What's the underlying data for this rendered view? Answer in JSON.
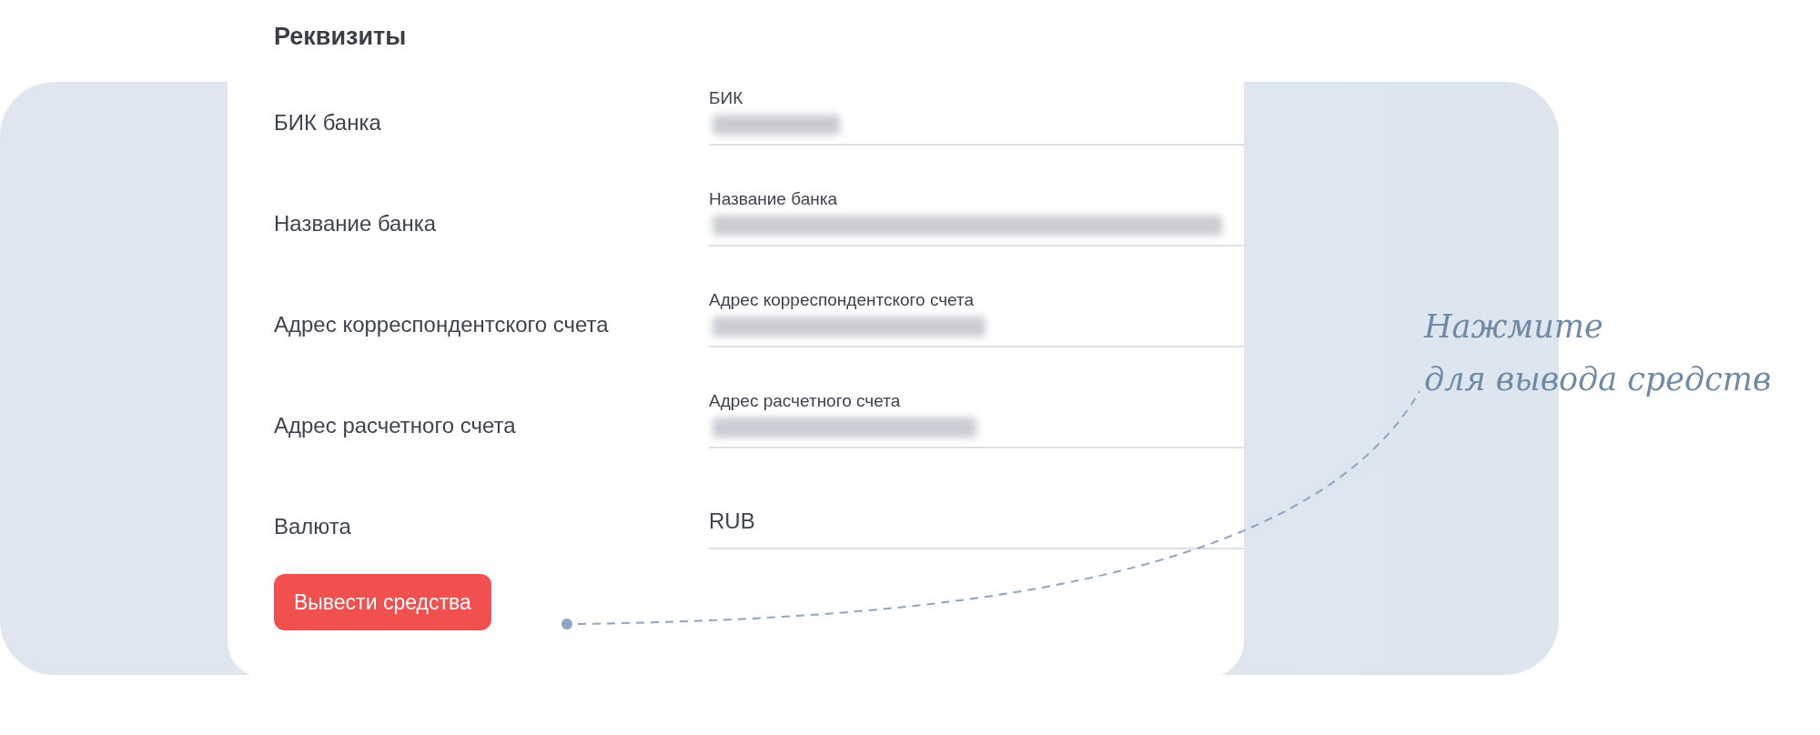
{
  "card": {
    "title": "Реквизиты",
    "rows": [
      {
        "label": "БИК банка",
        "field_label": "БИК",
        "kind": "masked"
      },
      {
        "label": "Название банка",
        "field_label": "Название банка",
        "kind": "masked"
      },
      {
        "label": "Адрес корреспондентского счета",
        "field_label": "Адрес корреспондентского счета",
        "kind": "masked"
      },
      {
        "label": "Адрес расчетного счета",
        "field_label": "Адрес расчетного счета",
        "kind": "masked"
      },
      {
        "label": "Валюта",
        "value": "RUB",
        "kind": "plain"
      }
    ],
    "button": "Вывести средства"
  },
  "annotation": [
    "Нажмите",
    "для вывода средств"
  ]
}
